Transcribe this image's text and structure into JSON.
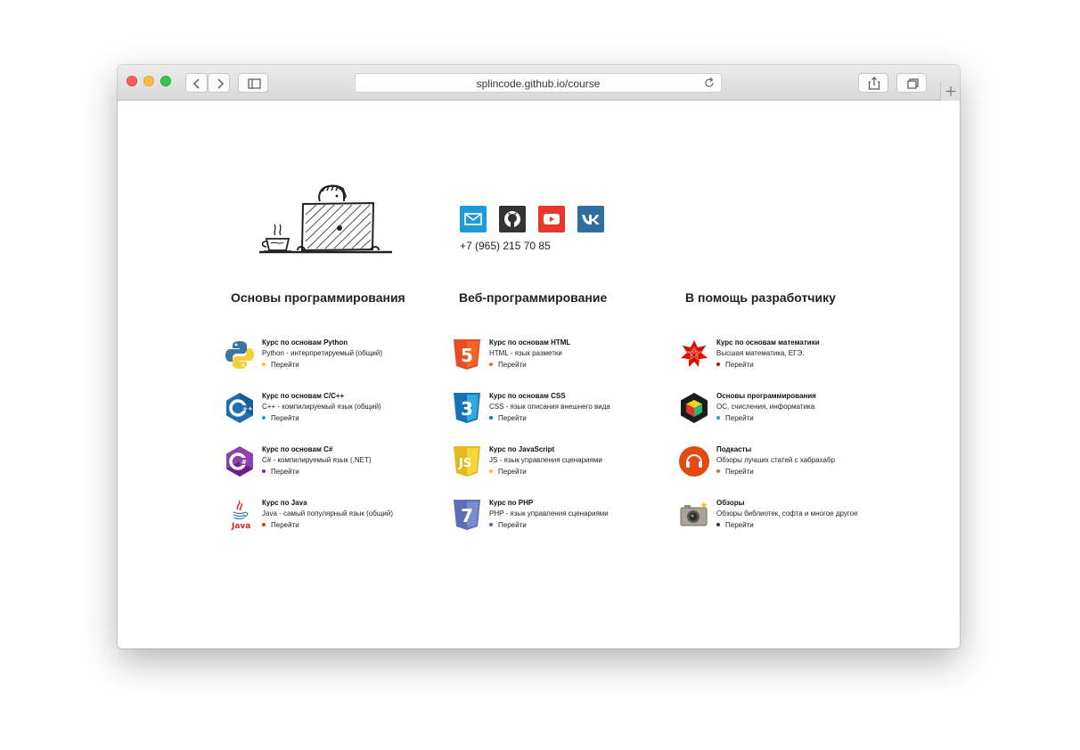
{
  "browser": {
    "url": "splincode.github.io/course",
    "buttons": {
      "back": "back-icon",
      "forward": "forward-icon",
      "sidebar": "sidebar-icon",
      "reload": "reload-icon",
      "share": "share-icon",
      "tabs": "tabs-icon",
      "new_tab": "plus-icon"
    }
  },
  "contact": {
    "phone": "+7 (965) 215 70 85",
    "socials": [
      {
        "name": "mail",
        "icon": "mail-icon",
        "color": "#1e9ad6"
      },
      {
        "name": "github",
        "icon": "github-icon",
        "color": "#333333"
      },
      {
        "name": "youtube",
        "icon": "youtube-icon",
        "color": "#e62117"
      },
      {
        "name": "vk",
        "icon": "vk-icon",
        "color": "#2f6fa0"
      }
    ]
  },
  "sections": [
    {
      "title": "Основы программирования",
      "items": [
        {
          "title": "Курс по основам Python",
          "desc": "Python - интерпретируемый (общий)",
          "link": "Перейти",
          "bullet": "#f5c21b",
          "icon": "python-icon"
        },
        {
          "title": "Курс по основам C/C++",
          "desc": "C++ - компилируемый язык (общий)",
          "link": "Перейти",
          "bullet": "#1aa3c4",
          "icon": "cpp-icon"
        },
        {
          "title": "Курс по основам C#",
          "desc": "C# - компилируемый язык (.NET)",
          "link": "Перейти",
          "bullet": "#7b2c8f",
          "icon": "csharp-icon"
        },
        {
          "title": "Курс по Java",
          "desc": "Java - самый популярный язык (общий)",
          "link": "Перейти",
          "bullet": "#e22b2b",
          "icon": "java-icon"
        }
      ]
    },
    {
      "title": "Веб-программирование",
      "items": [
        {
          "title": "Курс по основам HTML",
          "desc": "HTML - язык разметки",
          "link": "Перейти",
          "bullet": "#e96a20",
          "icon": "html5-icon"
        },
        {
          "title": "Курс по основам CSS",
          "desc": "CSS - язык описания внешнего вида",
          "link": "Перейти",
          "bullet": "#1b6bb8",
          "icon": "css3-icon"
        },
        {
          "title": "Курс по JavaScript",
          "desc": "JS - язык управления сценариями",
          "link": "Перейти",
          "bullet": "#f5c21b",
          "icon": "js-icon"
        },
        {
          "title": "Курс по PHP",
          "desc": "PHP - язык управления сценариями",
          "link": "Перейти",
          "bullet": "#5567ae",
          "icon": "php-icon"
        }
      ]
    },
    {
      "title": "В помощь разработчику",
      "items": [
        {
          "title": "Курс по основам математики",
          "desc": "Высшая математика, ЕГЭ.",
          "link": "Перейти",
          "bullet": "#b5121b",
          "icon": "wolfram-icon"
        },
        {
          "title": "Основы программирования",
          "desc": "ОС, счисления, информатика",
          "link": "Перейти",
          "bullet": "#1aa3c4",
          "icon": "cube-icon"
        },
        {
          "title": "Подкасты",
          "desc": "Обзоры лучших статей с хабрахабр",
          "link": "Перейти",
          "bullet": "#e96a20",
          "icon": "podcast-icon"
        },
        {
          "title": "Обзоры",
          "desc": "Обзоры библиотек, софта и многое другое",
          "link": "Перейти",
          "bullet": "#333333",
          "icon": "camera-icon"
        }
      ]
    }
  ]
}
